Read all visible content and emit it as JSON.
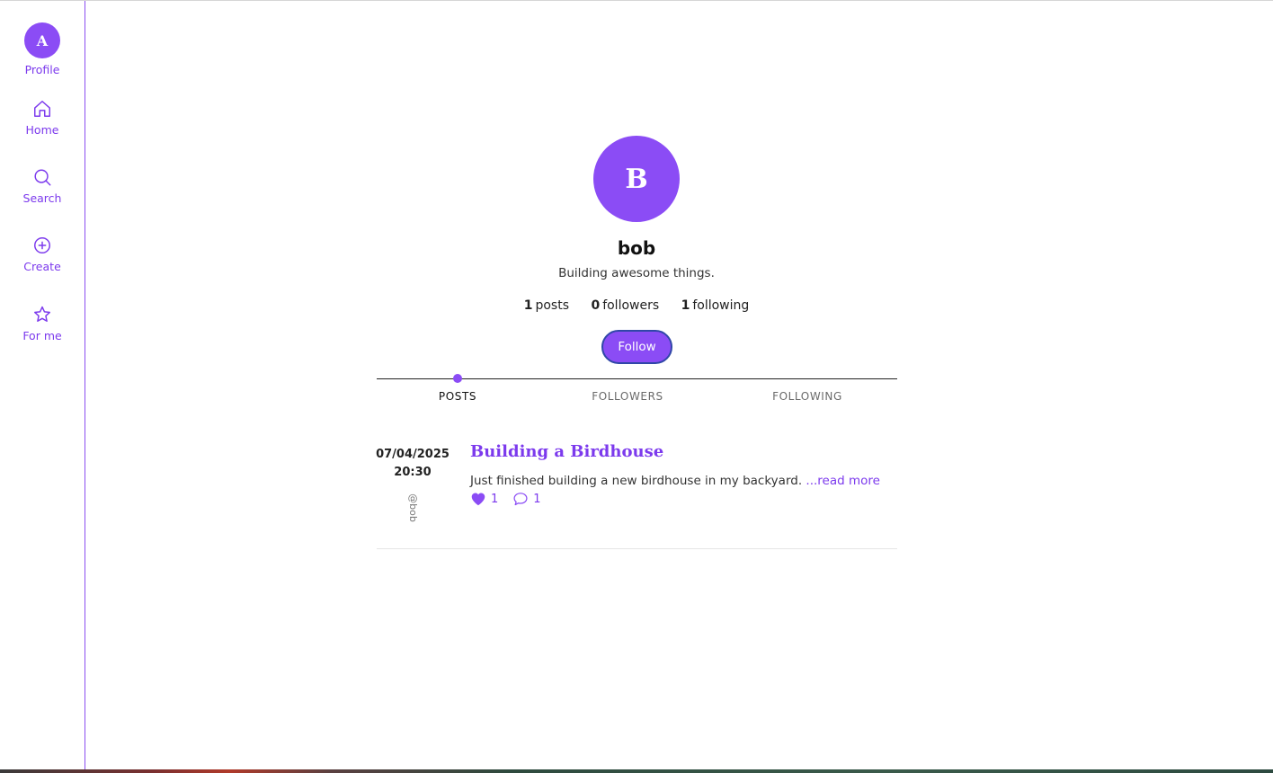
{
  "sidebar": {
    "profile": {
      "initial": "A",
      "label": "Profile"
    },
    "items": [
      {
        "label": "Home",
        "icon": "home-icon"
      },
      {
        "label": "Search",
        "icon": "search-icon"
      },
      {
        "label": "Create",
        "icon": "plus-circle-icon"
      },
      {
        "label": "For me",
        "icon": "star-icon"
      }
    ]
  },
  "profile": {
    "initial": "B",
    "username": "bob",
    "bio": "Building awesome things.",
    "stats": {
      "posts_count": "1",
      "posts_label": "posts",
      "followers_count": "0",
      "followers_label": "followers",
      "following_count": "1",
      "following_label": "following"
    },
    "follow_label": "Follow"
  },
  "tabs": [
    {
      "label": "POSTS",
      "active": true
    },
    {
      "label": "FOLLOWERS",
      "active": false
    },
    {
      "label": "FOLLOWING",
      "active": false
    }
  ],
  "posts": [
    {
      "date": "07/04/2025",
      "time": "20:30",
      "author": "@bob",
      "title": "Building a Birdhouse",
      "excerpt": "Just finished building a new birdhouse in my backyard.",
      "read_more": "...read more",
      "likes": "1",
      "comments": "1"
    }
  ],
  "colors": {
    "accent": "#8b4cf5",
    "accent_text": "#7c3aed",
    "follow_border": "#3047a8"
  }
}
